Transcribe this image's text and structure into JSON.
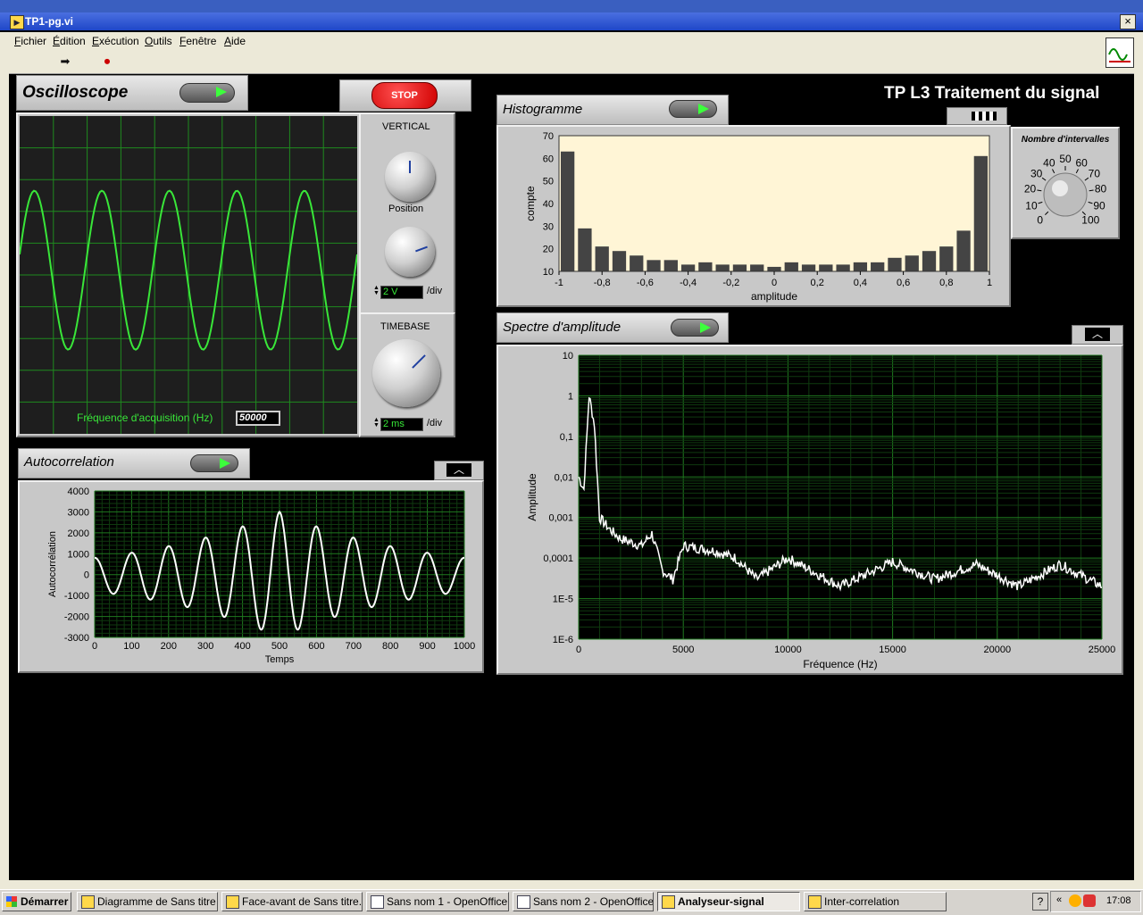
{
  "window": {
    "title": "TP1-pg.vi",
    "close": "×"
  },
  "menu": [
    "Fichier",
    "Édition",
    "Exécution",
    "Outils",
    "Fenêtre",
    "Aide"
  ],
  "toolbar": {
    "run_icon": "run-arrow-icon",
    "abort_icon": "abort-stop-icon"
  },
  "page_title": "TP L3 Traitement du signal",
  "stop_label": "STOP",
  "oscilloscope": {
    "title": "Oscilloscope",
    "freq_label": "Fréquence d'acquisition (Hz)",
    "freq_value": "50000",
    "vertical_label": "VERTICAL",
    "position_label": "Position",
    "volts_value": "2 V",
    "div_label": "/div",
    "timebase_label": "TIMEBASE",
    "time_value": "2 ms",
    "trace_color": "#39e639"
  },
  "histogram": {
    "title": "Histogramme",
    "intervals_label": "Nombre d'intervalles",
    "dial_ticks": [
      "0",
      "10",
      "20",
      "30",
      "40",
      "50",
      "60",
      "70",
      "80",
      "90",
      "100"
    ]
  },
  "spectrum": {
    "title": "Spectre d'amplitude"
  },
  "autocorr": {
    "title": "Autocorrelation"
  },
  "chart_data": [
    {
      "type": "line",
      "name": "oscilloscope",
      "grid": true,
      "description_series": "sinusoid",
      "x": [
        0,
        10
      ],
      "xlim": [
        0,
        10
      ],
      "ylim": [
        -5,
        5
      ],
      "cycles": 5.0,
      "amplitude": 2.5
    },
    {
      "type": "bar",
      "name": "histogram",
      "xlabel": "amplitude",
      "ylabel": "compte",
      "xticks": [
        "-1",
        "-0,8",
        "-0,6",
        "-0,4",
        "-0,2",
        "0",
        "0,2",
        "0,4",
        "0,6",
        "0,8",
        "1"
      ],
      "yticks": [
        "10",
        "20",
        "30",
        "40",
        "50",
        "60",
        "70"
      ],
      "xlim": [
        -1,
        1
      ],
      "ylim": [
        10,
        70
      ],
      "values": [
        63,
        29,
        21,
        19,
        17,
        15,
        15,
        13,
        14,
        13,
        13,
        13,
        12,
        14,
        13,
        13,
        13,
        14,
        14,
        16,
        17,
        19,
        21,
        28,
        61
      ]
    },
    {
      "type": "line",
      "name": "spectrum",
      "xlabel": "Fréquence (Hz)",
      "ylabel": "Amplitude",
      "xticks": [
        "0",
        "5000",
        "10000",
        "15000",
        "20000",
        "25000"
      ],
      "yticks": [
        "10",
        "1",
        "0,1",
        "0,01",
        "0,001",
        "0,0001",
        "1E-5",
        "1E-6"
      ],
      "xlim": [
        0,
        25000
      ],
      "ylim": [
        1e-06,
        10
      ],
      "log_y": true,
      "peaks": [
        [
          0,
          0.01
        ],
        [
          250,
          0.005
        ],
        [
          500,
          1.0
        ],
        [
          750,
          0.2
        ],
        [
          1000,
          0.001
        ],
        [
          1500,
          0.0005
        ],
        [
          2000,
          0.0003
        ],
        [
          3000,
          0.0002
        ],
        [
          3500,
          0.0004
        ],
        [
          4000,
          5e-05
        ],
        [
          4500,
          3e-05
        ],
        [
          5000,
          0.0002
        ],
        [
          6500,
          0.00015
        ],
        [
          7500,
          0.0001
        ],
        [
          8500,
          3e-05
        ],
        [
          10000,
          0.0001
        ],
        [
          12500,
          2e-05
        ],
        [
          15000,
          8e-05
        ],
        [
          17000,
          3e-05
        ],
        [
          19000,
          7e-05
        ],
        [
          21000,
          2e-05
        ],
        [
          23000,
          7e-05
        ],
        [
          25000,
          2e-05
        ]
      ]
    },
    {
      "type": "line",
      "name": "autocorrelation",
      "xlabel": "Temps",
      "ylabel": "Autocorrélation",
      "xticks": [
        "0",
        "100",
        "200",
        "300",
        "400",
        "500",
        "600",
        "700",
        "800",
        "900",
        "1000"
      ],
      "yticks": [
        "4000",
        "3000",
        "2000",
        "1000",
        "0",
        "-1000",
        "-2000",
        "-3000"
      ],
      "xlim": [
        0,
        1000
      ],
      "ylim": [
        -3000,
        4000
      ],
      "period": 100,
      "peak": 3000,
      "center": 500
    }
  ],
  "taskbar": {
    "start": "Démarrer",
    "tasks": [
      "Diagramme de Sans titre ...",
      "Face-avant de Sans titre...",
      "Sans nom 1 - OpenOffice...",
      "Sans nom 2 - OpenOffice...",
      "Analyseur-signal",
      "Inter-correlation"
    ],
    "clock": "17:08",
    "help": "?"
  }
}
